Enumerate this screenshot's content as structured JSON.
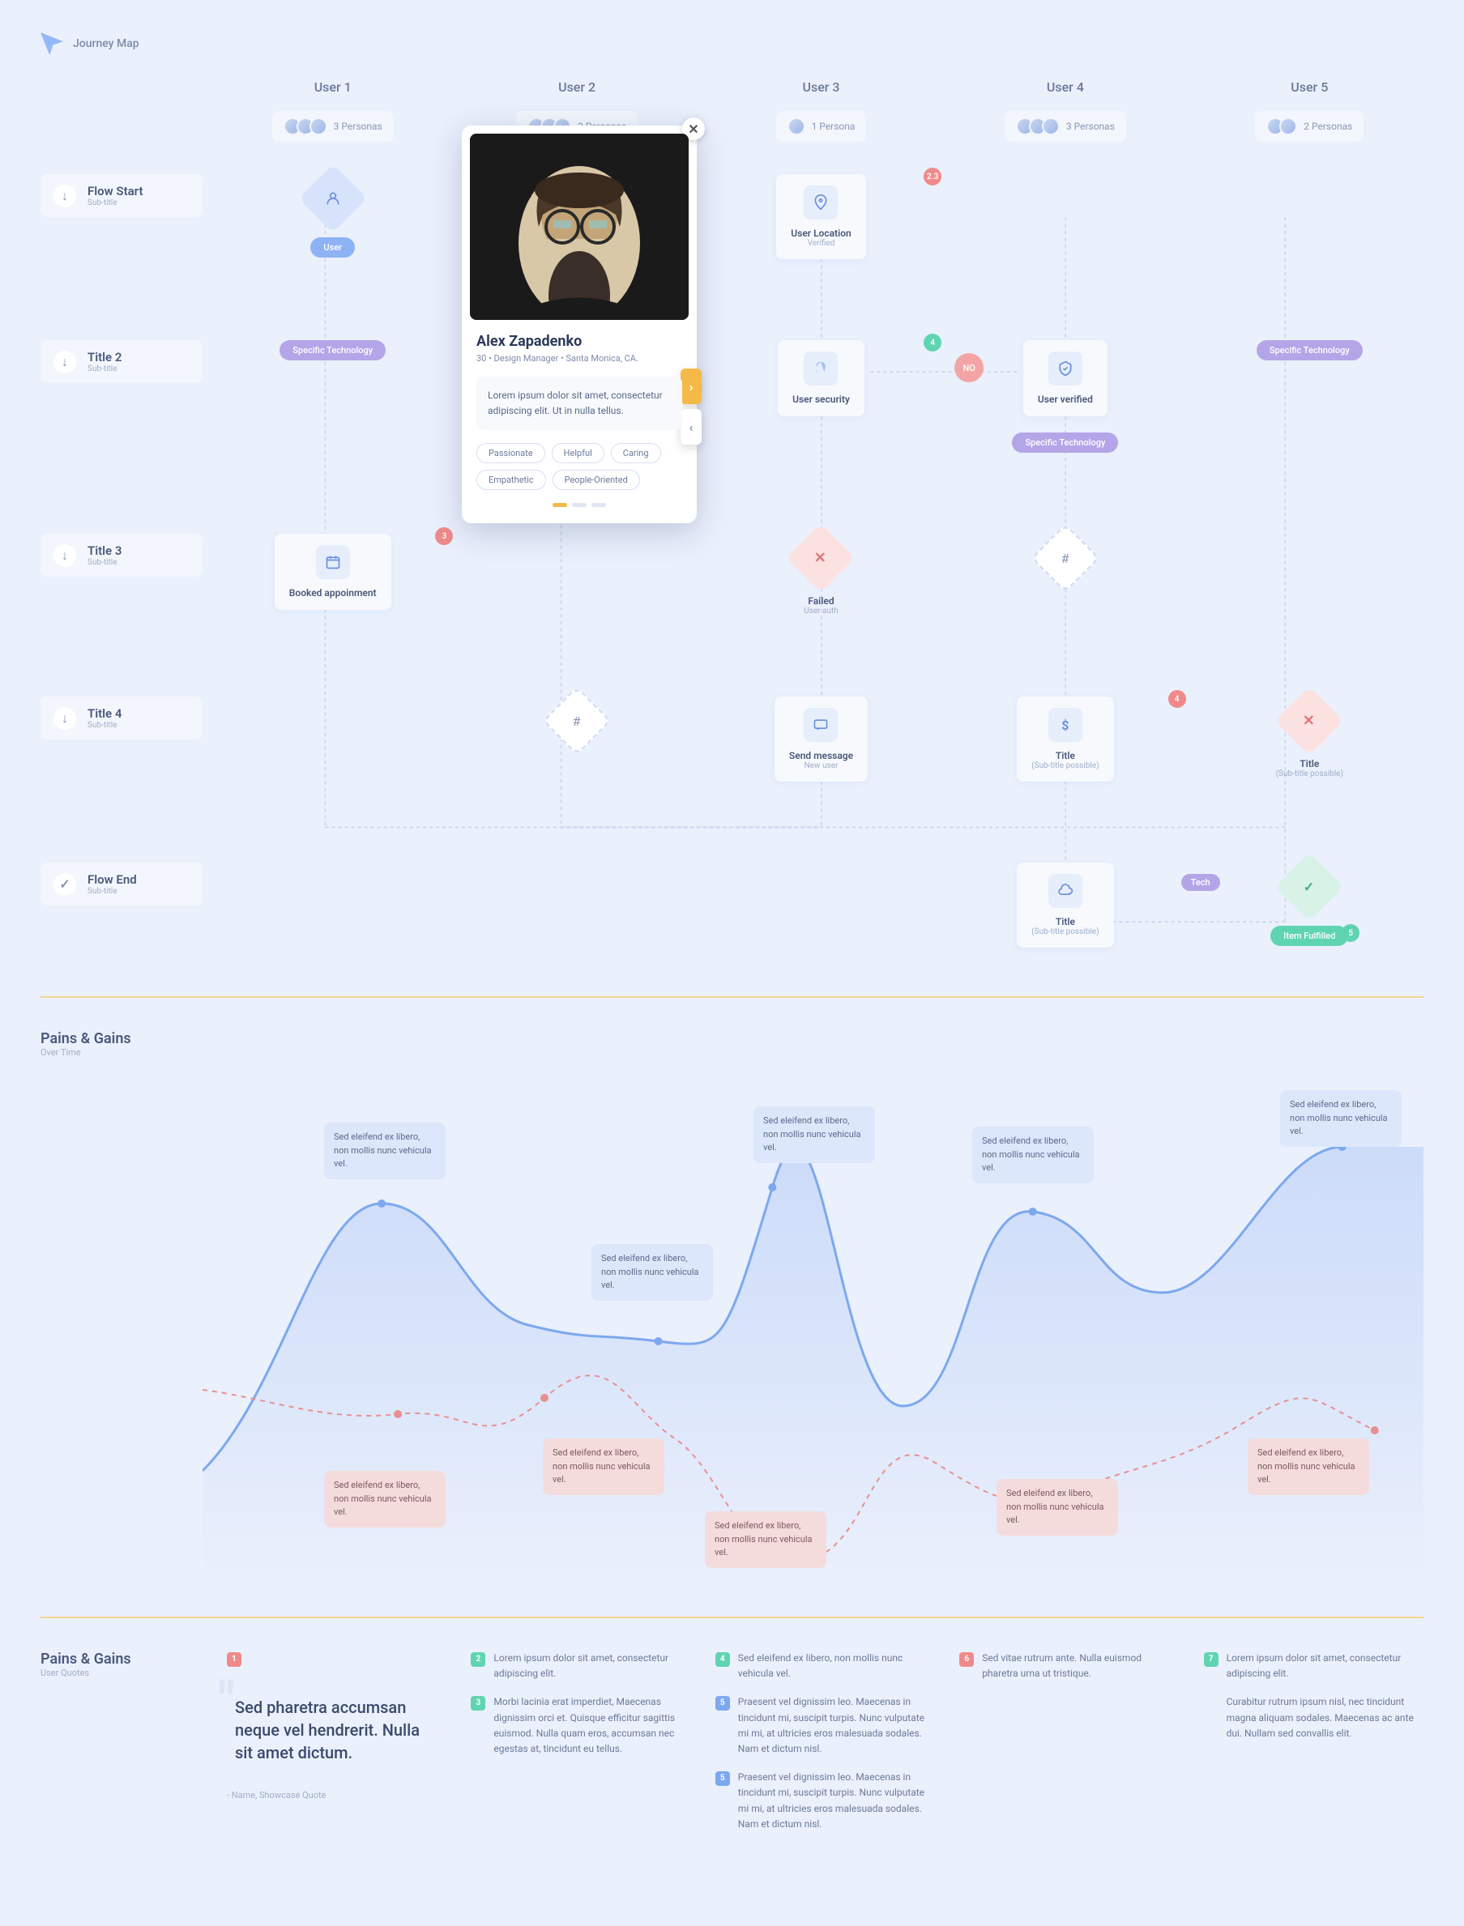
{
  "brand": "Journey Map",
  "users": [
    "User 1",
    "User 2",
    "User 3",
    "User 4",
    "User 5"
  ],
  "personas": [
    "3 Personas",
    "3 Personas",
    "1 Persona",
    "3 Personas",
    "2 Personas"
  ],
  "rows": [
    {
      "title": "Flow Start",
      "sub": "Sub-title",
      "icon": "↓"
    },
    {
      "title": "Title 2",
      "sub": "Sub-title",
      "icon": "↓"
    },
    {
      "title": "Title 3",
      "sub": "Sub-title",
      "icon": "↓"
    },
    {
      "title": "Title 4",
      "sub": "Sub-title",
      "icon": "↓"
    },
    {
      "title": "Flow End",
      "sub": "Sub-title",
      "icon": "✓"
    }
  ],
  "nodes": {
    "user_pill": "User",
    "tech_pill": "Specific Technology",
    "booked": {
      "title": "Booked appoinment"
    },
    "loc": {
      "title": "User Location",
      "sub": "Verified",
      "badge": "2.3"
    },
    "sec": {
      "title": "User security",
      "badge": "4"
    },
    "verified": {
      "title": "User verified"
    },
    "failed": {
      "title": "Failed",
      "sub": "User auth"
    },
    "no": "NO",
    "msg": {
      "title": "Send message",
      "sub": "New user"
    },
    "title_node": {
      "title": "Title",
      "sub": "(Sub-title possible)"
    },
    "tech_tag": "Tech",
    "fulfilled": "Item Fulfilled"
  },
  "persona": {
    "name": "Alex Zapadenko",
    "meta": "30 • Design Manager • Santa Monica, CA.",
    "quote": "Lorem ipsum dolor sit amet, consectetur adipiscing elit. Ut in nulla tellus.",
    "tags": [
      "Passionate",
      "Helpful",
      "Caring",
      "Empathetic",
      "People-Oriented"
    ]
  },
  "pains": {
    "title": "Pains & Gains",
    "sub": "Over Time",
    "tooltip": "Sed eleifend ex libero, non mollis nunc vehicula vel."
  },
  "quotes": {
    "title": "Pains & Gains",
    "sub": "User Quotes",
    "main": "Sed pharetra accumsan neque vel hendrerit. Nulla sit amet dictum.",
    "attr": "- Name, Showcase Quote",
    "cols": [
      [
        {
          "n": "1",
          "c": "red",
          "t": ""
        }
      ],
      [
        {
          "n": "2",
          "c": "green",
          "t": "Lorem ipsum dolor sit amet, consectetur adipiscing elit."
        },
        {
          "n": "3",
          "c": "green",
          "t": "Morbi lacinia erat imperdiet, Maecenas dignissim orci et. Quisque efficitur sagittis euismod. Nulla quam eros, accumsan nec egestas at, tincidunt eu tellus."
        }
      ],
      [
        {
          "n": "4",
          "c": "green",
          "t": "Sed eleifend ex libero, non mollis nunc vehicula vel."
        },
        {
          "n": "5",
          "c": "blue",
          "t": "Praesent vel dignissim leo. Maecenas in tincidunt mi, suscipit turpis. Nunc vulputate mi mi, at ultricies eros malesuada sodales. Nam et dictum nisl."
        },
        {
          "n": "5",
          "c": "blue",
          "t": "Praesent vel dignissim leo. Maecenas in tincidunt mi, suscipit turpis. Nunc vulputate mi mi, at ultricies eros malesuada sodales. Nam et dictum nisl."
        }
      ],
      [
        {
          "n": "6",
          "c": "red",
          "t": "Sed vitae rutrum ante. Nulla euismod pharetra urna ut tristique."
        }
      ],
      [
        {
          "n": "7",
          "c": "green",
          "t": "Lorem ipsum dolor sit amet, consectetur adipiscing elit."
        },
        {
          "n": "",
          "c": "",
          "t": "Curabitur rutrum ipsum nisl, nec tincidunt magna aliquam sodales. Maecenas ac ante dui. Nullam sed convallis elit."
        }
      ]
    ]
  },
  "chart_data": {
    "type": "line",
    "x": [
      0,
      1,
      2,
      3,
      4,
      5,
      6,
      7,
      8,
      9
    ],
    "series": [
      {
        "name": "gains",
        "values": [
          20,
          80,
          55,
          52,
          48,
          90,
          35,
          82,
          60,
          95
        ],
        "style": "solid-blue"
      },
      {
        "name": "pains",
        "values": [
          50,
          42,
          35,
          55,
          32,
          5,
          48,
          25,
          35,
          65
        ],
        "style": "dashed-red"
      }
    ],
    "ylim": [
      0,
      100
    ],
    "tooltips_gains": [
      {
        "x": 1,
        "y": 80
      },
      {
        "x": 3,
        "y": 52
      },
      {
        "x": 5,
        "y": 90
      },
      {
        "x": 7,
        "y": 82
      },
      {
        "x": 9,
        "y": 95
      }
    ],
    "tooltips_pains": [
      {
        "x": 1.7,
        "y": 38
      },
      {
        "x": 3.2,
        "y": 42
      },
      {
        "x": 5,
        "y": 5
      },
      {
        "x": 7,
        "y": 25
      },
      {
        "x": 8.6,
        "y": 45
      }
    ]
  }
}
